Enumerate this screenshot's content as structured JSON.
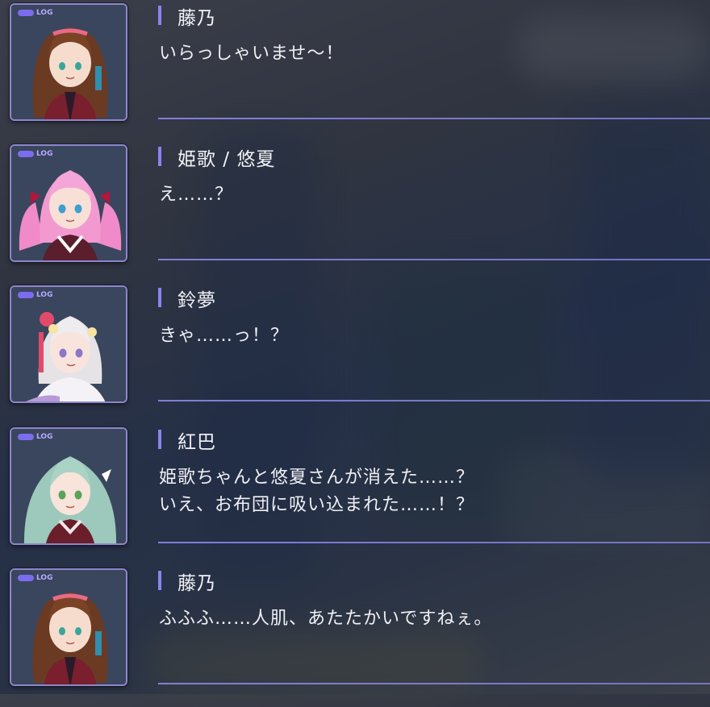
{
  "log_badge_label": "LOG",
  "accent_color": "#8a84f0",
  "entries": [
    {
      "speaker": "藤乃",
      "lines": [
        "いらっしゃいませ〜！"
      ],
      "avatar_icon": "fujino-portrait-icon"
    },
    {
      "speaker": "姫歌 / 悠夏",
      "lines": [
        "え……？"
      ],
      "avatar_icon": "himeka-portrait-icon"
    },
    {
      "speaker": "鈴夢",
      "lines": [
        "きゃ……っ！？"
      ],
      "avatar_icon": "suzume-portrait-icon"
    },
    {
      "speaker": "紅巴",
      "lines": [
        "姫歌ちゃんと悠夏さんが消えた……？",
        "いえ、お布団に吸い込まれた……！？"
      ],
      "avatar_icon": "tomoe-portrait-icon"
    },
    {
      "speaker": "藤乃",
      "lines": [
        "ふふふ……人肌、あたたかいですねぇ。"
      ],
      "avatar_icon": "fujino-portrait-icon"
    }
  ]
}
